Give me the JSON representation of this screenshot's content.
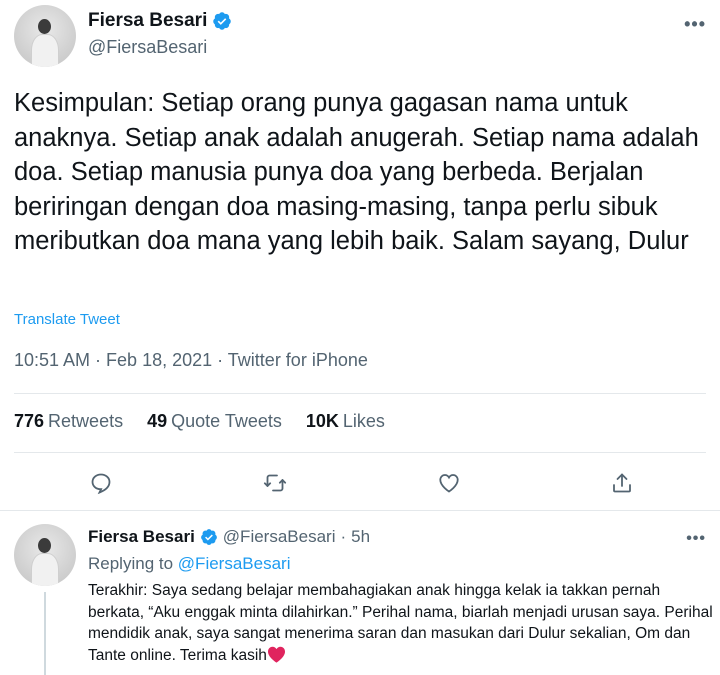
{
  "tweet": {
    "author": {
      "name": "Fiersa Besari",
      "handle": "@FiersaBesari",
      "verified": true
    },
    "more_label": "•••",
    "text": "Kesimpulan: Setiap orang punya gagasan nama untuk anaknya. Setiap anak adalah anugerah. Setiap nama adalah doa. Setiap manusia punya doa yang berbeda. Berjalan beriringan dengan doa masing-masing, tanpa perlu sibuk meributkan doa mana yang lebih baik. Salam sayang, Dulur",
    "translate_label": "Translate Tweet",
    "meta": "10:51 AM · Feb 18, 2021 · Twitter for iPhone",
    "stats": {
      "retweets": {
        "count": "776",
        "label": "Retweets"
      },
      "quotes": {
        "count": "49",
        "label": "Quote Tweets"
      },
      "likes": {
        "count": "10K",
        "label": "Likes"
      }
    },
    "actions": [
      "reply-icon",
      "retweet-icon",
      "like-icon",
      "share-icon"
    ]
  },
  "reply": {
    "author": {
      "name": "Fiersa Besari",
      "handle": "@FiersaBesari",
      "time": "5h",
      "separator": "·"
    },
    "more_label": "•••",
    "replying_prefix": "Replying to",
    "replying_to": "@FiersaBesari",
    "text": "Terakhir: Saya sedang belajar membahagiakan anak hingga kelak ia takkan pernah berkata, “Aku enggak minta dilahirkan.” Perihal nama, biarlah menjadi urusan saya. Perihal mendidik anak, saya sangat menerima saran dan masukan dari Dulur sekalian, Om dan Tante online. Terima kasih",
    "emoji": "heart-icon"
  },
  "colors": {
    "accent": "#1d9bf0",
    "secondary_text": "#536471",
    "primary_text": "#0f1419",
    "heart": "#e0245e"
  }
}
